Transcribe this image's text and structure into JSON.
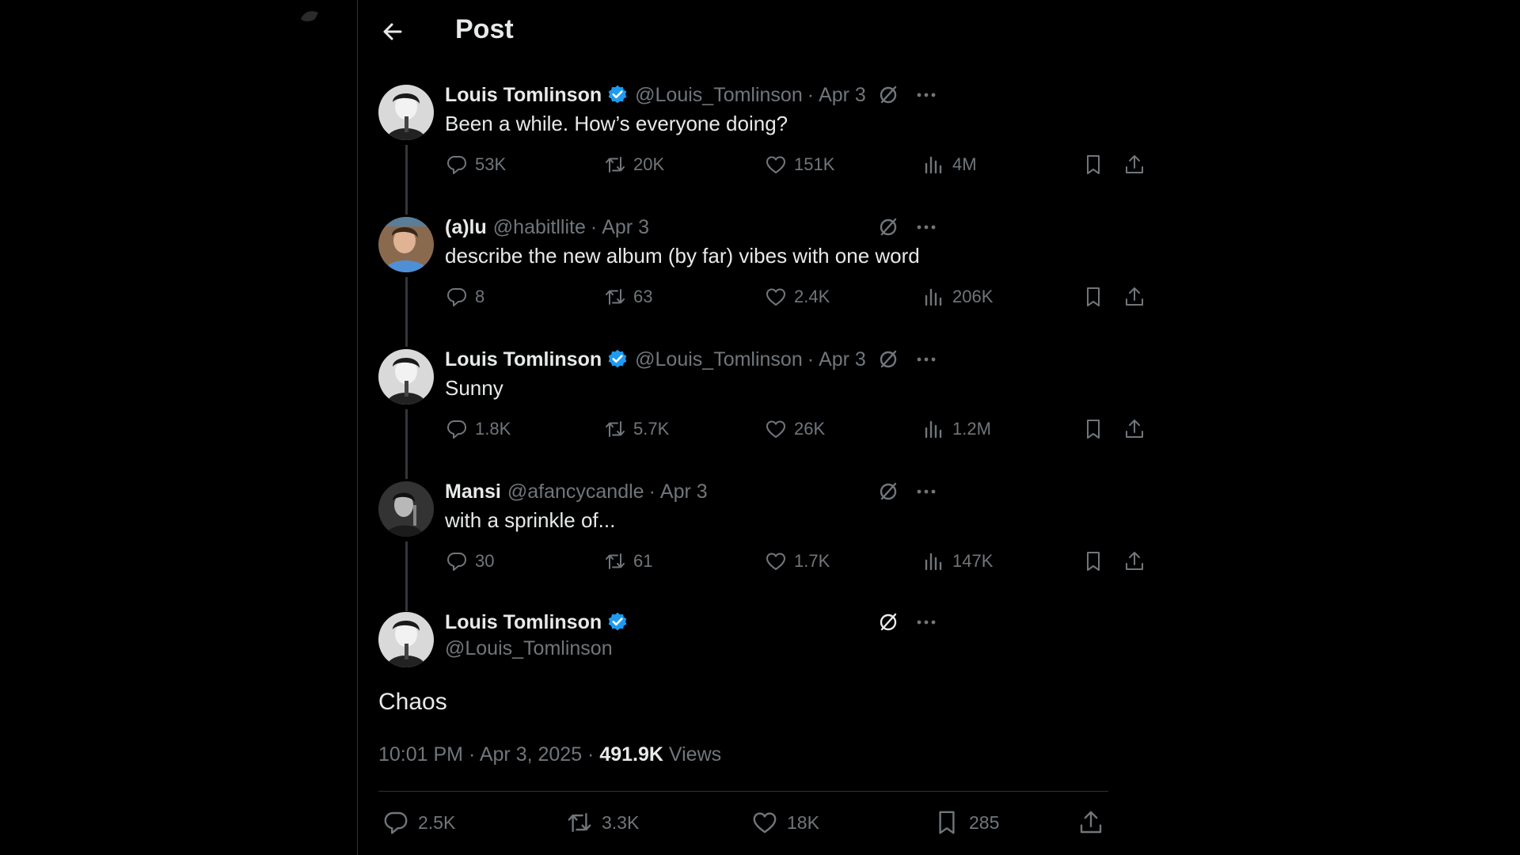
{
  "header": {
    "title": "Post",
    "back_icon": "arrow-left-icon"
  },
  "colors": {
    "background": "#000000",
    "text": "#e7e9ea",
    "secondary": "#71767b",
    "verified": "#1d9bf0",
    "border": "#2f3336"
  },
  "thread": [
    {
      "name": "Louis Tomlinson",
      "verified": true,
      "handle": "@Louis_Tomlinson",
      "date": "Apr 3",
      "text": "Been a while. How’s everyone doing?",
      "replies": "53K",
      "reposts": "20K",
      "likes": "151K",
      "views": "4M"
    },
    {
      "name": "(a)lu",
      "verified": false,
      "handle": "@habitllite",
      "date": "Apr 3",
      "text": "describe the new album (by far) vibes with one word",
      "replies": "8",
      "reposts": "63",
      "likes": "2.4K",
      "views": "206K"
    },
    {
      "name": "Louis Tomlinson",
      "verified": true,
      "handle": "@Louis_Tomlinson",
      "date": "Apr 3",
      "text": "Sunny",
      "replies": "1.8K",
      "reposts": "5.7K",
      "likes": "26K",
      "views": "1.2M"
    },
    {
      "name": "Mansi",
      "verified": false,
      "handle": "@afancycandle",
      "date": "Apr 3",
      "text": "with a sprinkle of...",
      "replies": "30",
      "reposts": "61",
      "likes": "1.7K",
      "views": "147K"
    }
  ],
  "main": {
    "name": "Louis Tomlinson",
    "verified": true,
    "handle": "@Louis_Tomlinson",
    "text": "Chaos",
    "timestamp": "10:01 PM · Apr 3, 2025 · ",
    "views_count": "491.9K",
    "views_label": " Views",
    "replies": "2.5K",
    "reposts": "3.3K",
    "likes": "18K",
    "bookmarks": "285"
  }
}
